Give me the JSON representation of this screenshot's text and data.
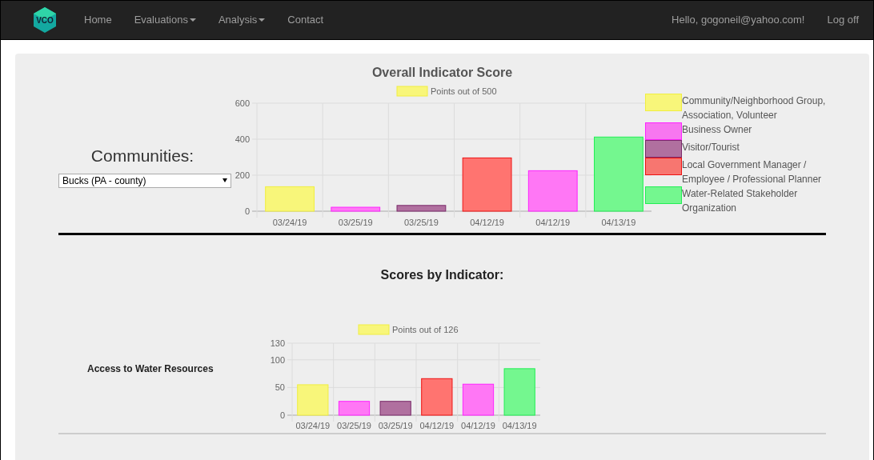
{
  "navbar": {
    "logo_text": "VCO",
    "links": [
      {
        "label": "Home",
        "dropdown": false
      },
      {
        "label": "Evaluations",
        "dropdown": true
      },
      {
        "label": "Analysis",
        "dropdown": true
      },
      {
        "label": "Contact",
        "dropdown": false
      }
    ],
    "greeting": "Hello, gogoneil@yahoo.com!",
    "logoff": "Log off"
  },
  "overall": {
    "title": "Overall Indicator Score",
    "communities_label": "Communities:",
    "community_select": "Bucks (PA - county)",
    "chart_data": {
      "type": "bar",
      "categories": [
        "03/24/19",
        "03/25/19",
        "03/25/19",
        "04/12/19",
        "04/12/19",
        "04/13/19"
      ],
      "series": [
        {
          "name": "Points out of 500",
          "values": [
            136,
            22,
            32,
            296,
            225,
            412
          ]
        }
      ],
      "ylim": [
        0,
        600
      ],
      "yticks": [
        0,
        200,
        400,
        600
      ]
    },
    "legend_swatch": {
      "color": "#f8f67a"
    },
    "bars": [
      {
        "color": "#f8f67a"
      },
      {
        "color": "#ff77f5"
      },
      {
        "color": "#b0709f"
      },
      {
        "color": "#ff7470"
      },
      {
        "color": "#ff77f5"
      },
      {
        "color": "#74f78f"
      }
    ],
    "legend": [
      {
        "label": "Community/Neighborhood Group, Association, Volunteer",
        "color": "#f8f67a"
      },
      {
        "label": "Business Owner",
        "color": "#f777f0"
      },
      {
        "label": "Visitor/Tourist",
        "color": "#b0709f"
      },
      {
        "label": "Local Government Manager / Employee / Professional Planner",
        "color": "#f77670"
      },
      {
        "label": "Water-Related Stakeholder Organization",
        "color": "#74f78f"
      }
    ]
  },
  "indicators": {
    "title": "Scores by Indicator:",
    "items": [
      {
        "label": "Access to Water Resources",
        "chart_data": {
          "type": "bar",
          "categories": [
            "03/24/19",
            "03/25/19",
            "03/25/19",
            "04/12/19",
            "04/12/19",
            "04/13/19"
          ],
          "series": [
            {
              "name": "Points out of 126",
              "values": [
                55,
                25,
                25,
                66,
                56,
                84
              ]
            }
          ],
          "ylim": [
            0,
            130
          ],
          "yticks": [
            0,
            50,
            100,
            130
          ]
        },
        "legend_swatch": {
          "color": "#f8f67a"
        },
        "bars": [
          {
            "color": "#f8f67a"
          },
          {
            "color": "#ff77f5"
          },
          {
            "color": "#b0709f"
          },
          {
            "color": "#ff7470"
          },
          {
            "color": "#ff77f5"
          },
          {
            "color": "#74f78f"
          }
        ]
      }
    ]
  }
}
